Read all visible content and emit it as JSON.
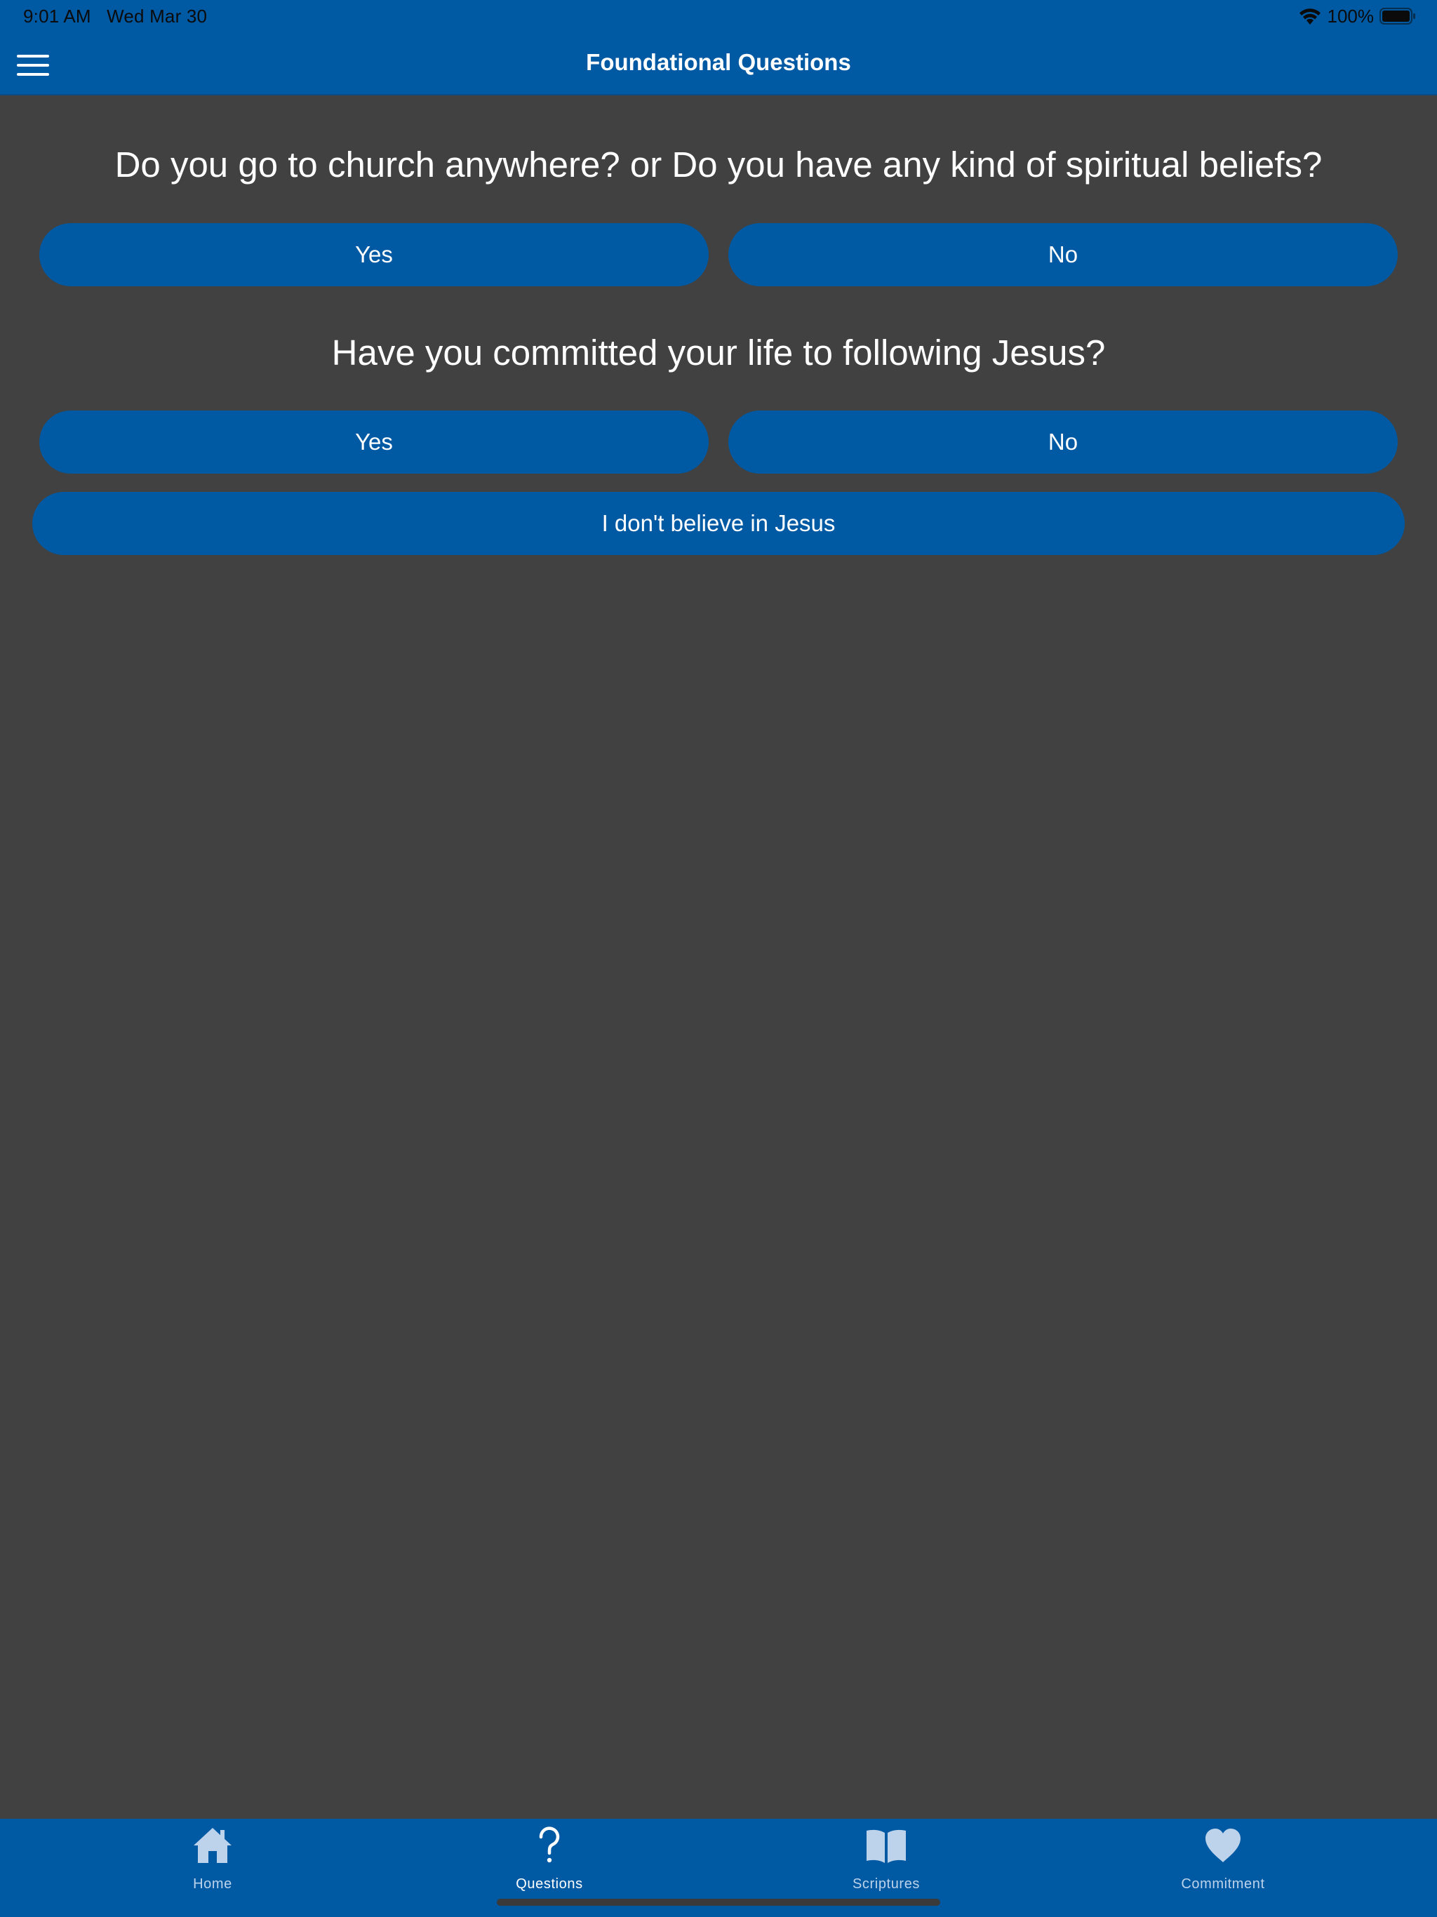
{
  "status_bar": {
    "time_date": "9:01 AM   Wed Mar 30",
    "battery": "100%"
  },
  "nav": {
    "title": "Foundational Questions"
  },
  "questions": [
    {
      "text": "Do you go to church anywhere? or Do you have any kind of spiritual beliefs?",
      "options": [
        "Yes",
        "No"
      ]
    },
    {
      "text": "Have you committed your life to following Jesus?",
      "options": [
        "Yes",
        "No"
      ],
      "extra_option": "I don't believe in Jesus"
    }
  ],
  "tabs": [
    {
      "label": "Home",
      "icon": "home-icon",
      "active": false
    },
    {
      "label": "Questions",
      "icon": "question-mark-icon",
      "active": true
    },
    {
      "label": "Scriptures",
      "icon": "book-icon",
      "active": false
    },
    {
      "label": "Commitment",
      "icon": "heart-icon",
      "active": false
    }
  ],
  "colors": {
    "brand_blue": "#0059a3",
    "background": "#414141",
    "tab_inactive": "#bcd3eb",
    "tab_active": "#ffffff"
  }
}
